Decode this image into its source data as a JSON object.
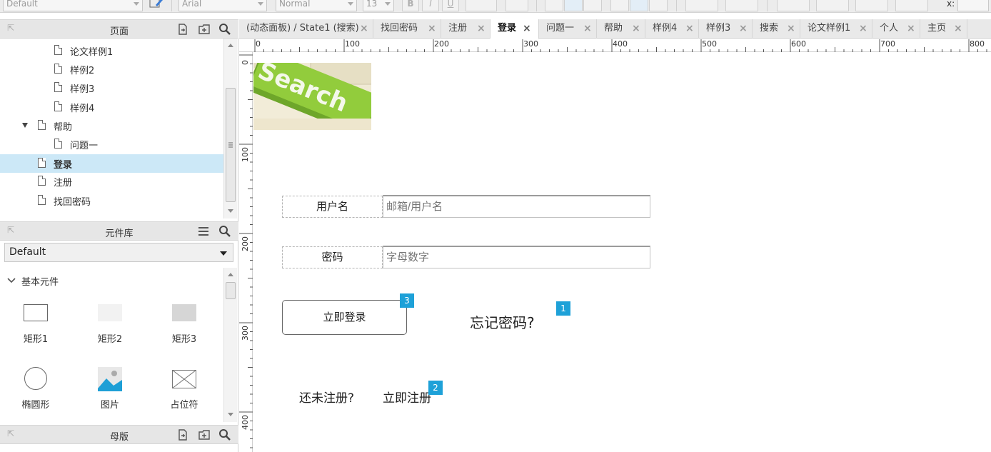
{
  "toolbar": {
    "font_style": "Default",
    "font_family": "Arial",
    "font_weight": "Normal",
    "font_size": "13",
    "bold_label": "B",
    "italic_label": "I",
    "underline_label": "U",
    "x_label": "x:"
  },
  "pages_panel": {
    "title": "页面",
    "items": [
      {
        "label": "论文样例1"
      },
      {
        "label": "样例2"
      },
      {
        "label": "样例3"
      },
      {
        "label": "样例4"
      },
      {
        "label": "帮助"
      },
      {
        "label": "问题一"
      },
      {
        "label": "登录"
      },
      {
        "label": "注册"
      },
      {
        "label": "找回密码"
      }
    ]
  },
  "library_panel": {
    "title": "元件库",
    "selected_library": "Default",
    "category": "基本元件",
    "widgets": [
      {
        "label": "矩形1",
        "icon": "rectangle-icon"
      },
      {
        "label": "矩形2",
        "icon": "rectangle-light-icon"
      },
      {
        "label": "矩形3",
        "icon": "rectangle-gray-icon"
      },
      {
        "label": "椭圆形",
        "icon": "ellipse-icon"
      },
      {
        "label": "图片",
        "icon": "image-icon"
      },
      {
        "label": "占位符",
        "icon": "placeholder-icon"
      }
    ]
  },
  "masters_panel": {
    "title": "母版"
  },
  "tabs": [
    {
      "label": "(动态面板) / State1 (搜索)"
    },
    {
      "label": "找回密码"
    },
    {
      "label": "注册"
    },
    {
      "label": "登录"
    },
    {
      "label": "问题一"
    },
    {
      "label": "帮助"
    },
    {
      "label": "样例4"
    },
    {
      "label": "样例3"
    },
    {
      "label": "搜索"
    },
    {
      "label": "论文样例1"
    },
    {
      "label": "个人"
    },
    {
      "label": "主页"
    }
  ],
  "active_tab": "登录",
  "ruler": {
    "h_labels": [
      "0",
      "100",
      "200",
      "300",
      "400",
      "500",
      "600",
      "700",
      "800"
    ],
    "v_labels": [
      "0",
      "100",
      "200",
      "300",
      "400"
    ]
  },
  "canvas": {
    "search_image_text": "Search",
    "username_label": "用户名",
    "username_placeholder": "邮箱/用户名",
    "password_label": "密码",
    "password_placeholder": "字母数字",
    "login_button": "立即登录",
    "forgot_password": "忘记密码?",
    "not_registered": "还未注册?",
    "register_now": "立即注册",
    "badges": {
      "forgot": "1",
      "register": "2",
      "login": "3"
    }
  },
  "colors": {
    "selection": "#cce8f7",
    "badge": "#1ea1d8",
    "search_key": "#8cc63f"
  }
}
